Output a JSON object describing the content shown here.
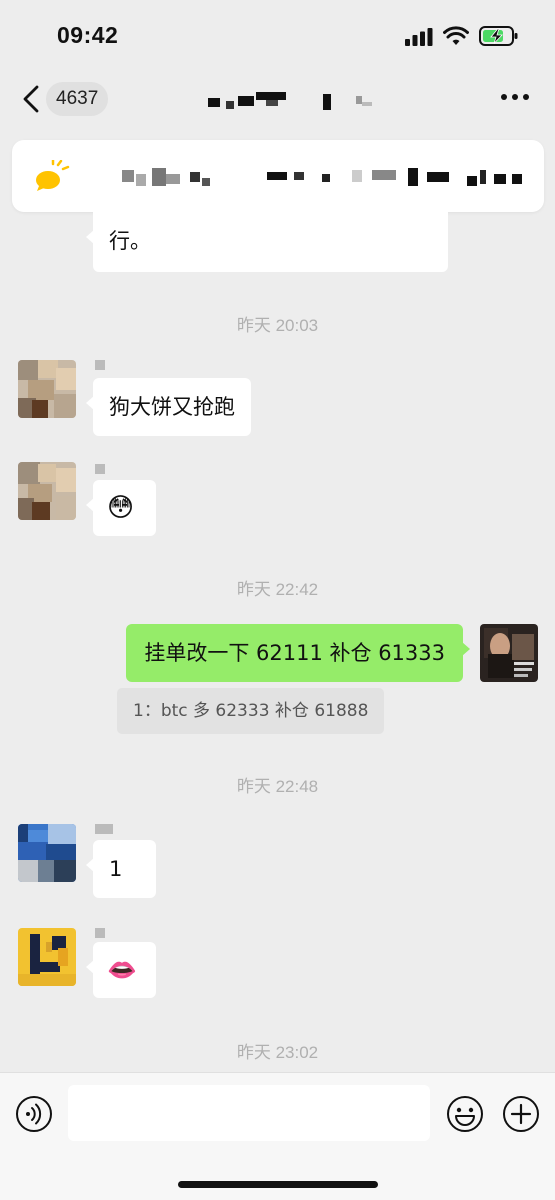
{
  "status_bar": {
    "time": "09:42"
  },
  "nav": {
    "unread_count": "4637"
  },
  "messages": [
    {
      "type": "text",
      "side": "left",
      "text": "行。"
    },
    {
      "type": "timestamp",
      "text": "昨天 20:03"
    },
    {
      "type": "text",
      "side": "left",
      "text": "狗大饼又抢跑"
    },
    {
      "type": "emoji",
      "side": "left",
      "emoji": "😳"
    },
    {
      "type": "timestamp",
      "text": "昨天 22:42"
    },
    {
      "type": "text",
      "side": "right",
      "text": "挂单改一下 62111 补仓 61333"
    },
    {
      "type": "quote",
      "text": "1：btc 多 62333 补仓 61888"
    },
    {
      "type": "timestamp",
      "text": "昨天 22:48"
    },
    {
      "type": "text",
      "side": "left",
      "text": "1"
    },
    {
      "type": "emoji",
      "side": "left",
      "emoji": "👄"
    },
    {
      "type": "timestamp",
      "text": "昨天 23:02"
    }
  ],
  "icons": {
    "back": "chevron-left-icon",
    "more": "more-icon",
    "notice": "speaker-icon",
    "voice": "voice-icon",
    "emoji": "smile-icon",
    "plus": "plus-icon"
  },
  "colors": {
    "accent_green": "#95ec69",
    "battery_green": "#4cd964",
    "background": "#ededed"
  }
}
